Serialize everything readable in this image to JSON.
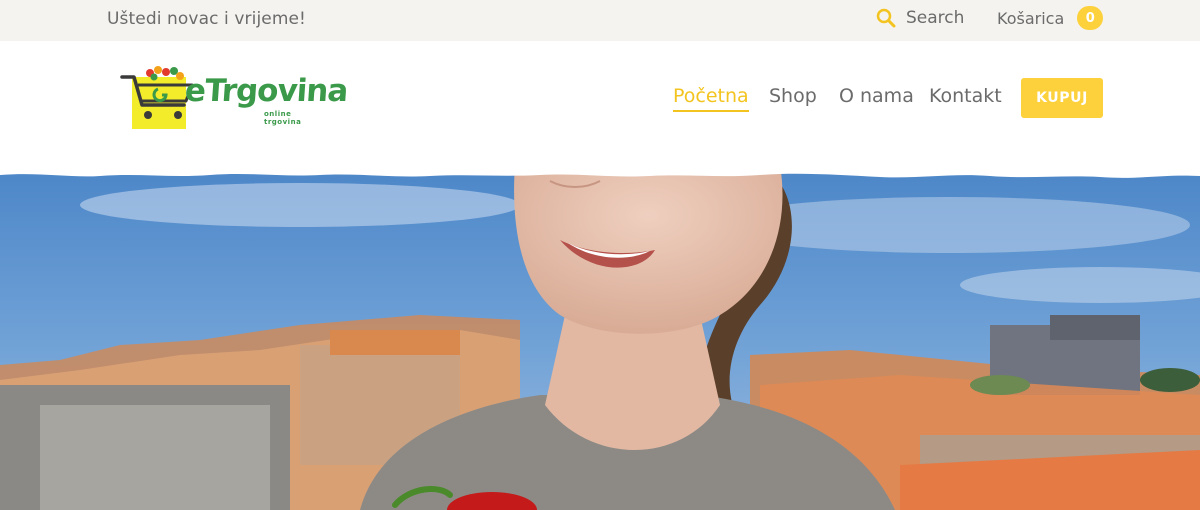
{
  "topbar": {
    "tagline": "Uštedi novac i vrijeme!",
    "search_label": "Search",
    "cart_label": "Košarica",
    "cart_count": "0"
  },
  "logo": {
    "name": "eTrgovina",
    "subtitle": "online trgovina"
  },
  "nav": {
    "items": [
      {
        "label": "Početna",
        "active": true
      },
      {
        "label": "Shop",
        "active": false
      },
      {
        "label": "O nama",
        "active": false
      },
      {
        "label": "Kontakt",
        "active": false
      }
    ],
    "cta_label": "KUPUJ"
  },
  "colors": {
    "accent": "#fdd13c",
    "active_nav": "#f3c41f",
    "logo_green": "#3a9a4a",
    "text_gray": "#6b6b6b",
    "topbar_bg": "#f4f3ef"
  },
  "icons": {
    "search": "search-icon",
    "logo": "shopping-cart-logo-icon"
  }
}
